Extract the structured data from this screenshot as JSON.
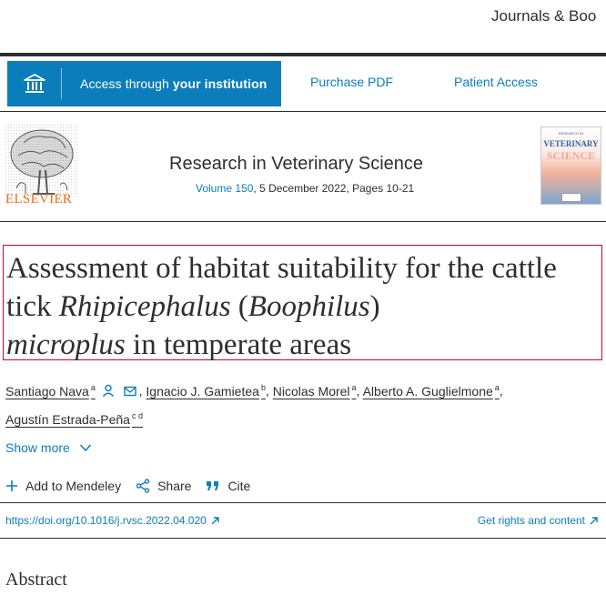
{
  "top_nav": {
    "journals_link": "Journals & Boo"
  },
  "access": {
    "institution_prefix": "Access through ",
    "institution_bold": "your institution",
    "purchase_pdf": "Purchase PDF",
    "patient_access": "Patient Access"
  },
  "journal": {
    "publisher": "ELSEVIER",
    "name": "Research in Veterinary Science",
    "volume": "Volume 150",
    "date_pages": ", 5 December 2022, Pages 10-21",
    "cover_top": "RESEARCH IN",
    "cover_title": "VETERINARY",
    "cover_title2": "SCIENCE"
  },
  "article": {
    "title_part1": "Assessment of habitat suitability for the cattle tick ",
    "title_italic1": "Rhipicephalus",
    "title_part2": " (",
    "title_italic2": "Boophilus",
    "title_part3": ")",
    "title_italic3": "microplus",
    "title_part4": " in temperate areas"
  },
  "authors": [
    {
      "name": "Santiago Nava",
      "sup": "a"
    },
    {
      "name": "Ignacio J. Gamietea",
      "sup": "b"
    },
    {
      "name": "Nicolas Morel",
      "sup": "a"
    },
    {
      "name": "Alberto A. Guglielmone",
      "sup": "a"
    },
    {
      "name": "Agustín Estrada-Peña",
      "sup": "c d"
    }
  ],
  "show_more": "Show more",
  "actions": {
    "mendeley": "Add to Mendeley",
    "share": "Share",
    "cite": "Cite"
  },
  "doi": "https://doi.org/10.1016/j.rvsc.2022.04.020",
  "rights": "Get rights and content",
  "abstract_heading": "Abstract",
  "colors": {
    "accent": "#0c7dbb",
    "publisher": "#e9711c",
    "highlight_box": "#d3002c",
    "text": "#2e2e2e"
  },
  "icons": [
    "institution-icon",
    "elsevier-tree-logo",
    "person-icon",
    "envelope-icon",
    "chevron-down-icon",
    "plus-icon",
    "share-icon",
    "quote-icon",
    "external-arrow-icon"
  ]
}
